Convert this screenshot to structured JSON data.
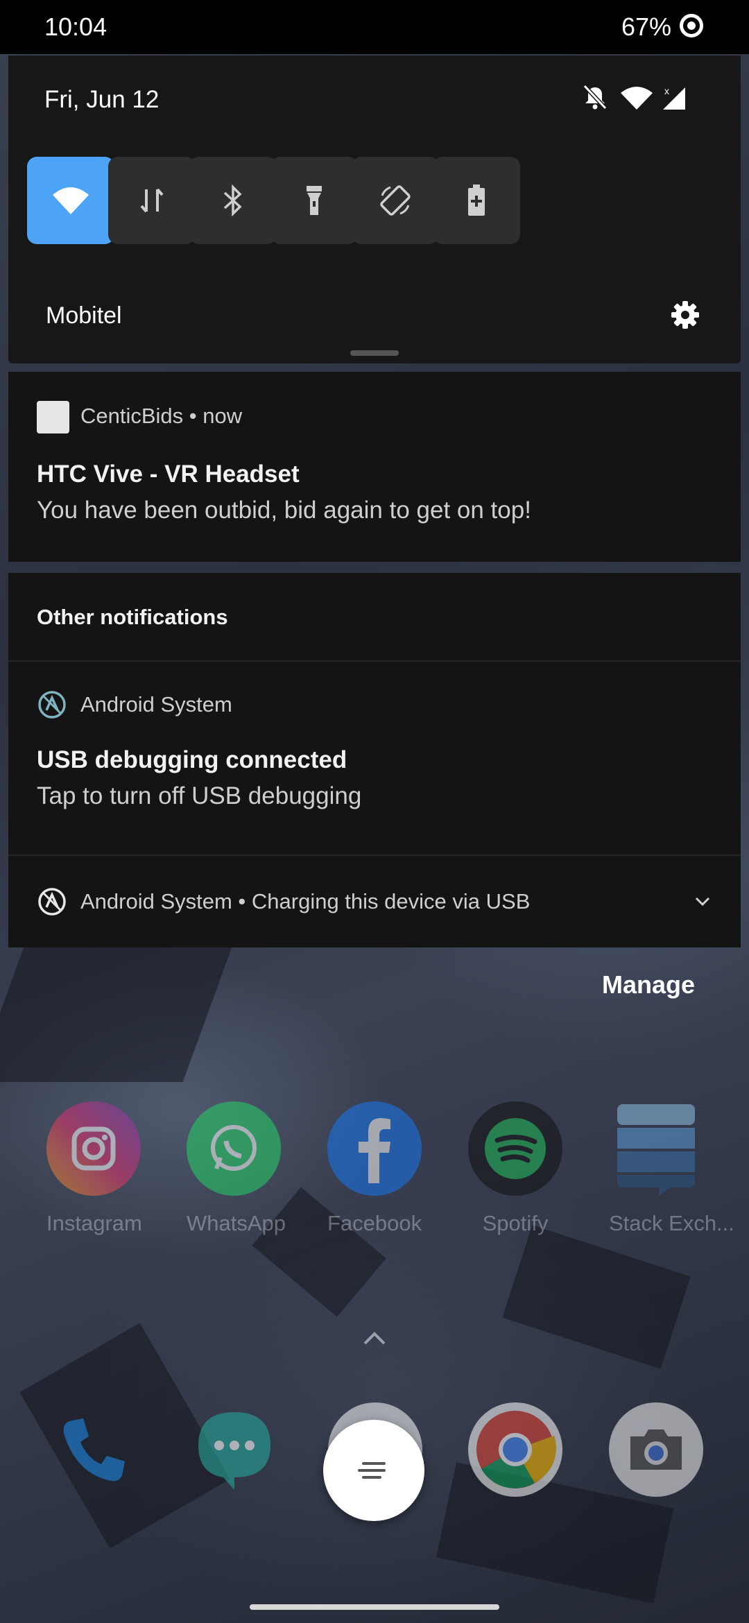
{
  "status_bar": {
    "time": "10:04",
    "battery": "67%"
  },
  "quick_settings": {
    "date": "Fri, Jun 12",
    "carrier": "Mobitel",
    "tiles": [
      "wifi-icon",
      "mobile-data-icon",
      "bluetooth-icon",
      "flashlight-icon",
      "auto-rotate-icon",
      "battery-saver-icon"
    ],
    "accent": "#4da3f5"
  },
  "notifications": {
    "bid": {
      "app_line": "CenticBids • now",
      "title": "HTC Vive - VR Headset",
      "text": "You have been outbid, bid again to get on top!"
    },
    "other": {
      "header": "Other notifications",
      "usb_debug": {
        "app": "Android System",
        "title": "USB debugging connected",
        "text": "Tap to turn off USB debugging"
      },
      "charging": {
        "line": "Android System • Charging this device via USB"
      }
    },
    "manage_label": "Manage"
  },
  "home": {
    "apps": [
      {
        "label": "Instagram"
      },
      {
        "label": "WhatsApp"
      },
      {
        "label": "Facebook"
      },
      {
        "label": "Spotify"
      },
      {
        "label": "Stack Exch..."
      }
    ]
  }
}
